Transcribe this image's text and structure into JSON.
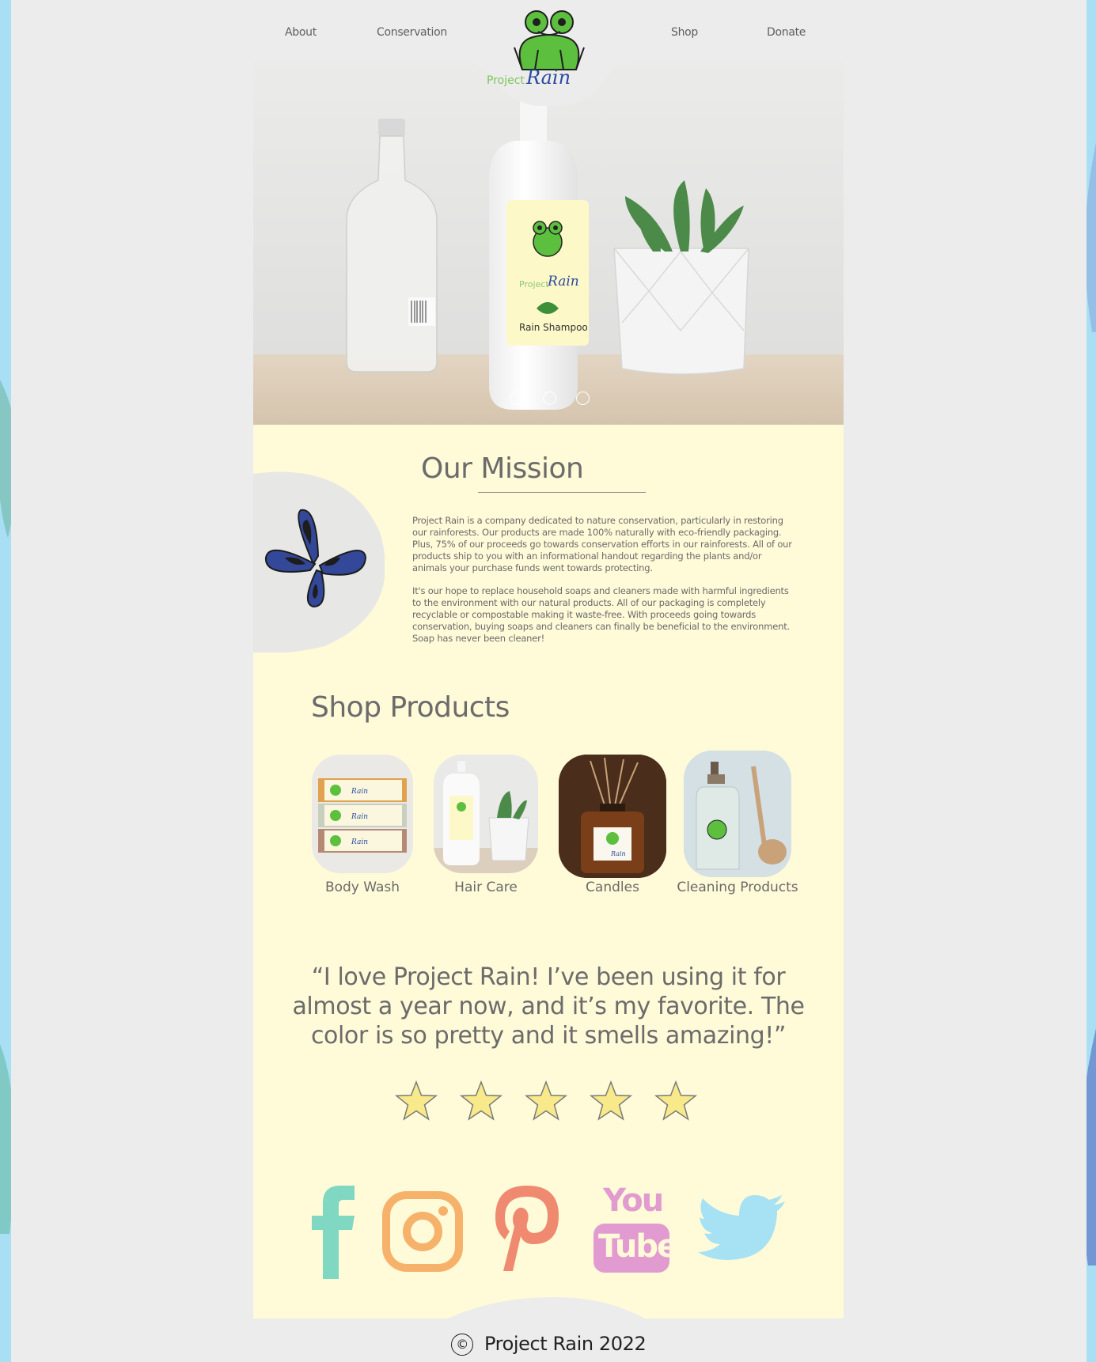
{
  "nav": {
    "about": "About",
    "conservation": "Conservation",
    "shop": "Shop",
    "donate": "Donate"
  },
  "logo": {
    "project": "Project",
    "rain": "Rain"
  },
  "hero": {
    "label_project": "Project",
    "label_rain": "Rain",
    "label_product": "Rain Shampoo",
    "slides": 3
  },
  "mission": {
    "title": "Our Mission",
    "paragraph1": "Project Rain is a company dedicated to nature conservation, particularly in restoring our rainforests. Our products are made 100% naturally with eco-friendly packaging. Plus, 75% of our proceeds go towards conservation efforts in our rainforests. All of our products ship to you with an informational handout regarding the plants and/or animals your purchase funds went towards protecting.",
    "paragraph2": "It's our hope to replace household soaps and cleaners made with harmful ingredients to the environment with our natural products. All of our packaging is completely recyclable or compostable making it waste-free. With proceeds going towards conservation, buying soaps and cleaners can finally be beneficial to the environment. Soap has never been cleaner!"
  },
  "shop": {
    "title": "Shop Products",
    "products": [
      {
        "label": "Body Wash"
      },
      {
        "label": "Hair Care"
      },
      {
        "label": "Candles"
      },
      {
        "label": "Cleaning Products"
      }
    ]
  },
  "testimonial": {
    "quote": "“I love Project Rain! I’ve been using it for almost a year now, and it’s my favorite. The color is so pretty and it smells amazing!”",
    "rating": 5,
    "max_rating": 5
  },
  "social": {
    "facebook": "facebook-icon",
    "instagram": "instagram-icon",
    "pinterest": "pinterest-icon",
    "youtube_you": "You",
    "youtube_tube": "Tube",
    "twitter": "twitter-icon"
  },
  "footer": {
    "copyright_symbol": "©",
    "text": "Project Rain 2022"
  },
  "colors": {
    "background_blue": "#a9dff5",
    "cream": "#fffad8",
    "grey": "#ececec",
    "frog_green": "#5cbf3e",
    "rain_blue": "#2c4a9e",
    "butterfly_blue": "#34489a",
    "star_yellow": "#f8ea8a",
    "facebook": "#80d7c2",
    "instagram": "#f6b26b",
    "pinterest": "#ef8a70",
    "youtube": "#e29bd0",
    "twitter": "#a6e2f3"
  }
}
